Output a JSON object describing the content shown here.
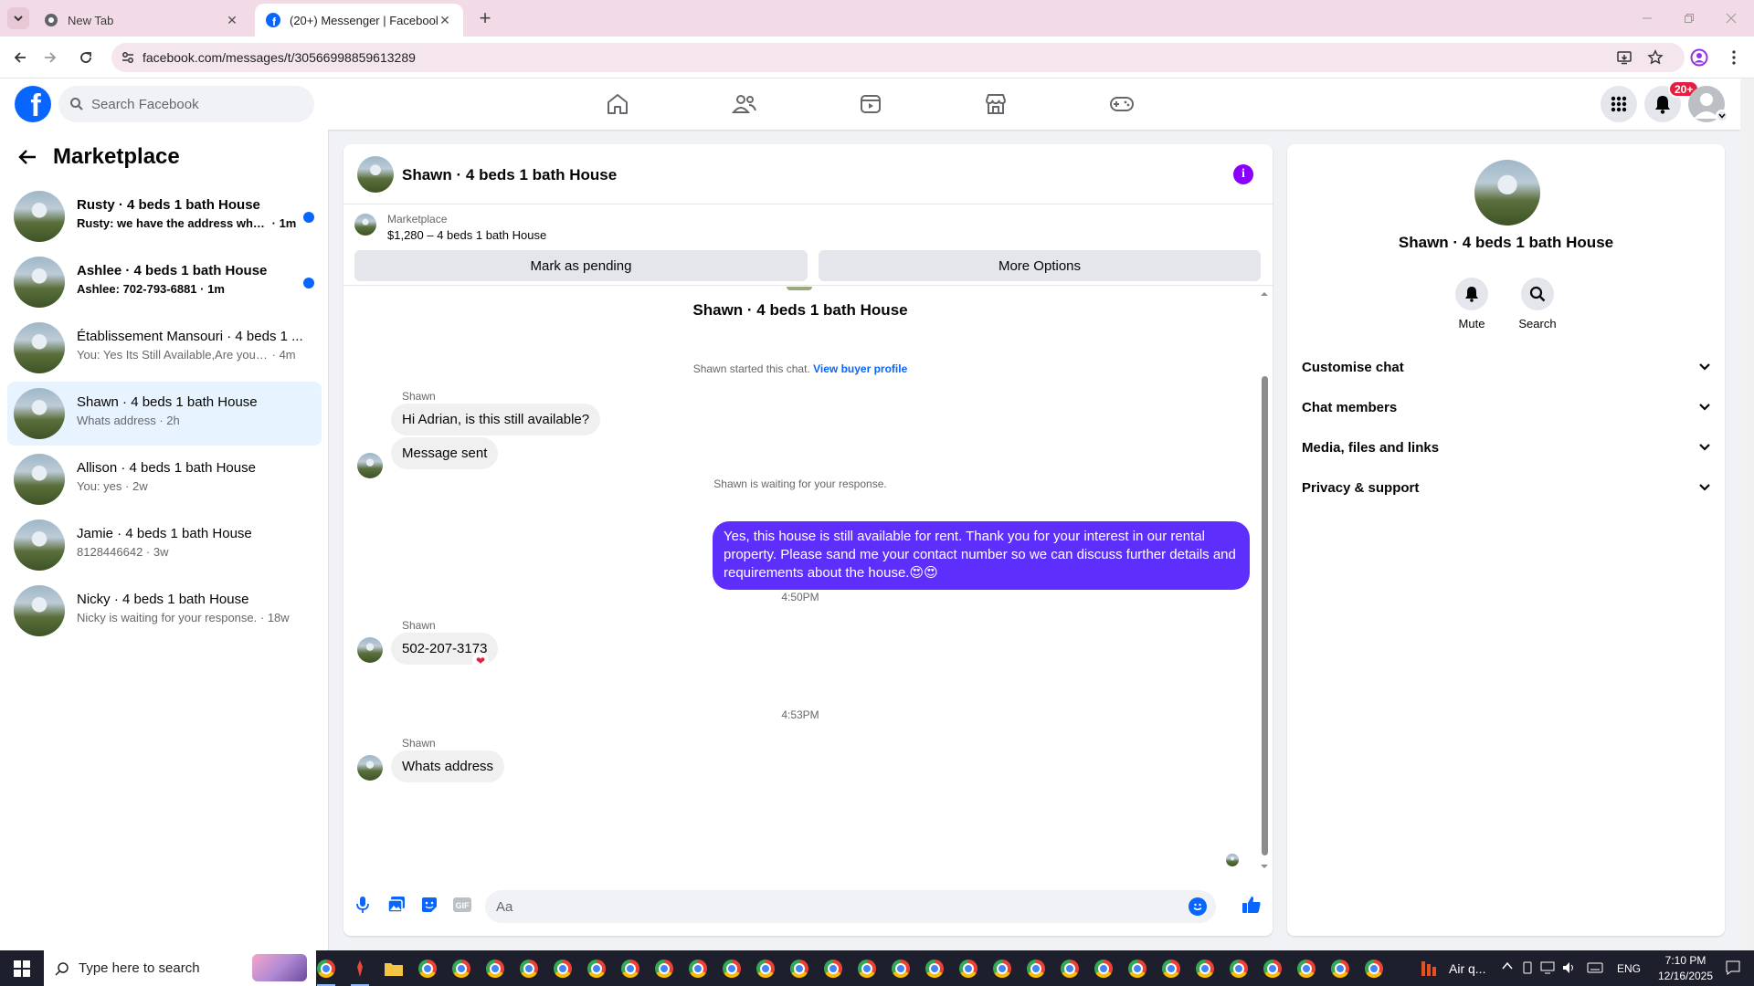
{
  "browser": {
    "tabs": [
      {
        "title": "New Tab",
        "active": false
      },
      {
        "title": "(20+) Messenger | Facebook",
        "active": true
      }
    ],
    "url": "facebook.com/messages/t/30566998859613289"
  },
  "header": {
    "search_placeholder": "Search Facebook",
    "notification_badge": "20+",
    "brand_color": "#0866ff"
  },
  "sidebar": {
    "title": "Marketplace",
    "conversations": [
      {
        "name": "Rusty · 4 beds 1 bath House",
        "preview": "Rusty: we have the address when ...",
        "time": "1m",
        "unread": true
      },
      {
        "name": "Ashlee · 4 beds 1 bath House",
        "preview": "Ashlee: 702-793-6881",
        "time": "1m",
        "unread": true
      },
      {
        "name": "Établissement Mansouri · 4 beds 1 ...",
        "preview": "You: Yes Its Still Available,Are you intr...",
        "time": "4m",
        "unread": false
      },
      {
        "name": "Shawn · 4 beds 1 bath House",
        "preview": "Whats address",
        "time": "2h",
        "unread": false,
        "active": true
      },
      {
        "name": "Allison · 4 beds 1 bath House",
        "preview": "You: yes",
        "time": "2w",
        "unread": false
      },
      {
        "name": "Jamie · 4 beds 1 bath House",
        "preview": "8128446642",
        "time": "3w",
        "unread": false
      },
      {
        "name": "Nicky · 4 beds 1 bath House",
        "preview": "Nicky is waiting for your response.",
        "time": "18w",
        "unread": false
      }
    ]
  },
  "chat": {
    "title": "Shawn · 4 beds 1 bath House",
    "listing": {
      "source": "Marketplace",
      "price_line": "$1,280 – 4 beds 1 bath House",
      "pending_button": "Mark as pending",
      "options_button": "More Options"
    },
    "thread_title": "Shawn · 4 beds 1 bath House",
    "started": "Shawn started this chat.",
    "buyer_profile_link": "View buyer profile",
    "sender_name": "Shawn",
    "msg1": "Hi Adrian, is this still available?",
    "msg2": "Message sent",
    "waiting": "Shawn is waiting for your response.",
    "outgoing": "Yes, this house is still available for rent. Thank you for your interest in our rental property. Please sand me your contact number so we can discuss further details and requirements about the house.😍😍",
    "time1": "4:50PM",
    "msg3": "502-207-3173",
    "reaction": "heart",
    "time2": "4:53PM",
    "msg4": "Whats address",
    "composer_placeholder": "Aa",
    "accent_color": "#5e2ffc"
  },
  "info_panel": {
    "name": "Shawn · 4 beds 1 bath House",
    "actions": [
      "Mute",
      "Search"
    ],
    "sections": [
      "Customise chat",
      "Chat members",
      "Media, files and links",
      "Privacy & support"
    ]
  },
  "taskbar": {
    "search_placeholder": "Type here to search",
    "weather": "Air q...",
    "language": "ENG",
    "time": "7:10 PM",
    "date": "12/16/2025"
  }
}
